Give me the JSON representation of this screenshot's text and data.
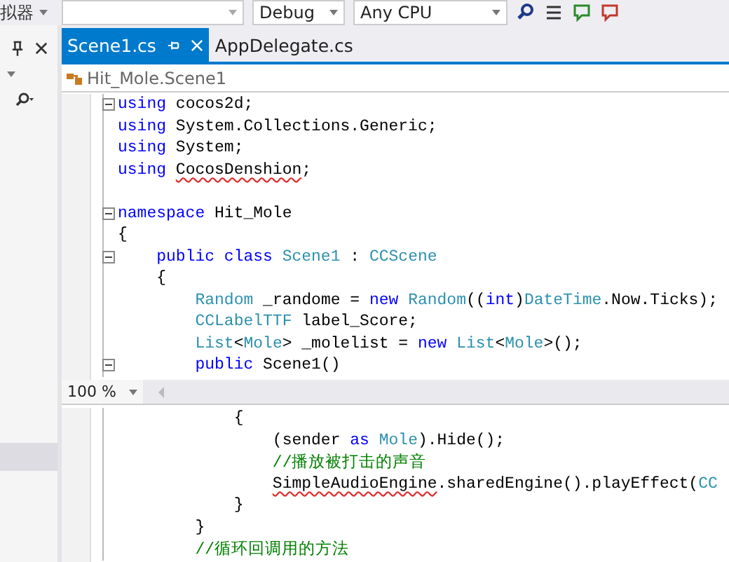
{
  "toolbar": {
    "target_label": "拟器",
    "config": "Debug",
    "platform": "Any CPU"
  },
  "tabs": [
    {
      "label": "Scene1.cs",
      "selected": true
    },
    {
      "label": "AppDelegate.cs",
      "selected": false
    }
  ],
  "breadcrumb": "Hit_Mole.Scene1",
  "top_pane": [
    {
      "fold": true,
      "segments": [
        {
          "kind": "kw",
          "text": "using "
        },
        {
          "kind": "plain",
          "text": "cocos2d;"
        }
      ]
    },
    {
      "fold": false,
      "segments": [
        {
          "kind": "kw",
          "text": "using "
        },
        {
          "kind": "plain",
          "text": "System.Collections.Generic;"
        }
      ]
    },
    {
      "fold": false,
      "segments": [
        {
          "kind": "kw",
          "text": "using "
        },
        {
          "kind": "plain",
          "text": "System;"
        }
      ]
    },
    {
      "fold": false,
      "segments": [
        {
          "kind": "kw",
          "text": "using "
        },
        {
          "kind": "plain",
          "text": "CocosDenshion",
          "error": true
        },
        {
          "kind": "plain",
          "text": ";"
        }
      ]
    },
    {
      "fold": false
    },
    {
      "fold": true,
      "segments": [
        {
          "kind": "kw",
          "text": "namespace "
        },
        {
          "kind": "plain",
          "text": "Hit_Mole"
        }
      ]
    },
    {
      "fold": false,
      "segments": [
        {
          "kind": "plain",
          "text": "{"
        }
      ]
    },
    {
      "fold": true,
      "segments": [
        {
          "kind": "kw",
          "text": "    public class "
        },
        {
          "kind": "type",
          "text": "Scene1"
        },
        {
          "kind": "plain",
          "text": " : "
        },
        {
          "kind": "type",
          "text": "CCScene"
        }
      ]
    },
    {
      "fold": false,
      "segments": [
        {
          "kind": "plain",
          "text": "    {"
        }
      ]
    },
    {
      "fold": false,
      "segments": [
        {
          "kind": "type",
          "text": "        Random"
        },
        {
          "kind": "plain",
          "text": " _randome = "
        },
        {
          "kind": "kw",
          "text": "new "
        },
        {
          "kind": "type",
          "text": "Random"
        },
        {
          "kind": "plain",
          "text": "(("
        },
        {
          "kind": "kw",
          "text": "int"
        },
        {
          "kind": "plain",
          "text": ")"
        },
        {
          "kind": "type",
          "text": "DateTime"
        },
        {
          "kind": "plain",
          "text": ".Now.Ticks);"
        }
      ]
    },
    {
      "fold": false,
      "segments": [
        {
          "kind": "type",
          "text": "        CCLabelTTF"
        },
        {
          "kind": "plain",
          "text": " label_Score;"
        }
      ]
    },
    {
      "fold": false,
      "segments": [
        {
          "kind": "type",
          "text": "        List"
        },
        {
          "kind": "plain",
          "text": "<"
        },
        {
          "kind": "type",
          "text": "Mole"
        },
        {
          "kind": "plain",
          "text": "> _molelist = "
        },
        {
          "kind": "kw",
          "text": "new "
        },
        {
          "kind": "type",
          "text": "List"
        },
        {
          "kind": "plain",
          "text": "<"
        },
        {
          "kind": "type",
          "text": "Mole"
        },
        {
          "kind": "plain",
          "text": ">();"
        }
      ]
    },
    {
      "fold": true,
      "segments": [
        {
          "kind": "kw",
          "text": "        public"
        },
        {
          "kind": "plain",
          "text": " Scene1()"
        }
      ]
    }
  ],
  "zoom": "100 %",
  "bottom_pane": [
    {
      "fold": false,
      "segments": [
        {
          "kind": "plain",
          "text": "            {"
        }
      ]
    },
    {
      "fold": false,
      "segments": [
        {
          "kind": "plain",
          "text": "                (sender "
        },
        {
          "kind": "kw",
          "text": "as "
        },
        {
          "kind": "type",
          "text": "Mole"
        },
        {
          "kind": "plain",
          "text": ").Hide();"
        }
      ]
    },
    {
      "fold": false,
      "segments": [
        {
          "kind": "comment",
          "text": "                //播放被打击的声音"
        }
      ]
    },
    {
      "fold": false,
      "segments": [
        {
          "kind": "plain",
          "text": "                SimpleAudioEngine",
          "error": true
        },
        {
          "kind": "plain",
          "text": ".sharedEngine().playEffect("
        },
        {
          "kind": "type",
          "text": "CC"
        }
      ]
    },
    {
      "fold": false,
      "segments": [
        {
          "kind": "plain",
          "text": "            }"
        }
      ]
    },
    {
      "fold": false,
      "segments": [
        {
          "kind": "plain",
          "text": "        }"
        }
      ]
    },
    {
      "fold": false,
      "segments": [
        {
          "kind": "comment",
          "text": "        //循环回调用的方法"
        }
      ]
    }
  ]
}
